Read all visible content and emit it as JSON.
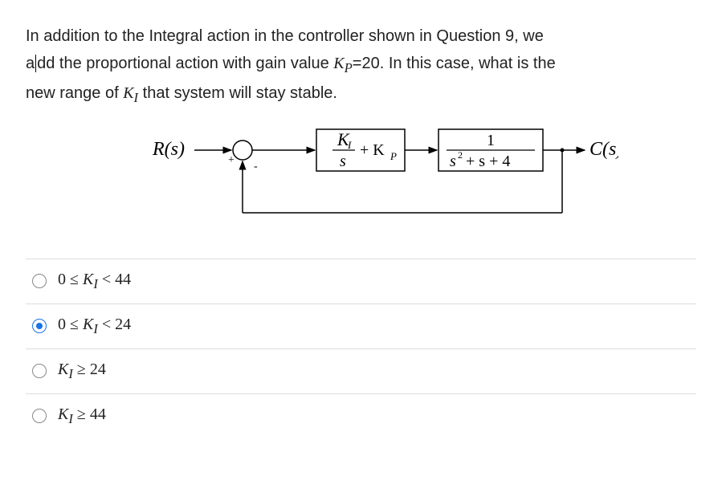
{
  "question": {
    "line1_pre": "In addition to the Integral action in the controller shown in Question 9, we",
    "line2_pre": "a",
    "line2_post": "dd the proportional action with gain value ",
    "kp_label": "K",
    "kp_sub": "P",
    "kp_value": "=20. In this case, what is the",
    "line3_pre": "new range of ",
    "ki_label": "K",
    "ki_sub": "I",
    "line3_post": " that system will stay stable."
  },
  "diagram": {
    "input": "R(s)",
    "output": "C(s)",
    "plus": "+",
    "minus": "-",
    "block1_top": "K",
    "block1_top_sub": "I",
    "block1_bot": "s",
    "block1_plus": "+ K",
    "block1_plus_sub": "P",
    "block2_top": "1",
    "block2_bot_a": "s",
    "block2_bot_exp": "2",
    "block2_bot_b": " + s + 4"
  },
  "options": [
    {
      "id": "opt1",
      "text_pre": "0 ≤ ",
      "var": "K",
      "sub": "I",
      "text_post": " < 44",
      "selected": false
    },
    {
      "id": "opt2",
      "text_pre": "0 ≤ ",
      "var": "K",
      "sub": "I",
      "text_post": " < 24",
      "selected": true
    },
    {
      "id": "opt3",
      "text_pre": "",
      "var": "K",
      "sub": "I",
      "text_post": " ≥ 24",
      "selected": false
    },
    {
      "id": "opt4",
      "text_pre": "",
      "var": "K",
      "sub": "I",
      "text_post": " ≥ 44",
      "selected": false
    }
  ]
}
